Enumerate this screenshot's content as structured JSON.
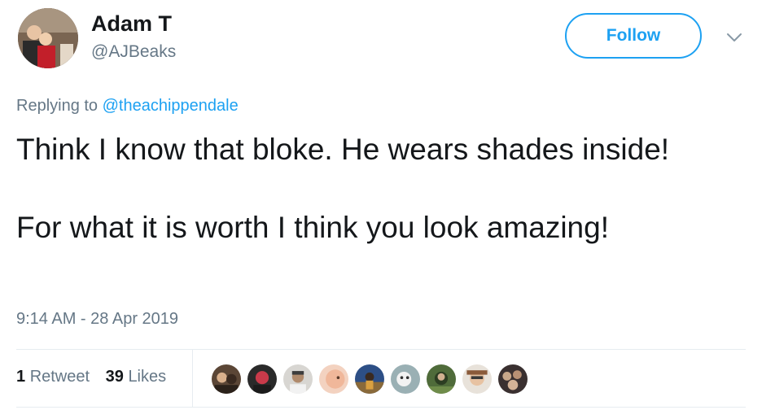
{
  "author": {
    "display_name": "Adam T",
    "handle": "@AJBeaks"
  },
  "follow_label": "Follow",
  "reply": {
    "prefix": "Replying to ",
    "mention": "@theachippendale"
  },
  "tweet": {
    "line1": "Think I know that bloke. He wears shades inside!",
    "line2": "For what it is worth I think you look amazing!"
  },
  "timestamp": "9:14 AM - 28 Apr 2019",
  "stats": {
    "retweet_count": "1",
    "retweet_label": "Retweet",
    "like_count": "39",
    "like_label": "Likes"
  },
  "icons": {
    "caret": "chevron-down-icon"
  },
  "colors": {
    "accent": "#1da1f2",
    "secondary_text": "#657786",
    "primary_text": "#14171a",
    "divider": "#e6ecf0"
  },
  "liker_count_shown": 9
}
